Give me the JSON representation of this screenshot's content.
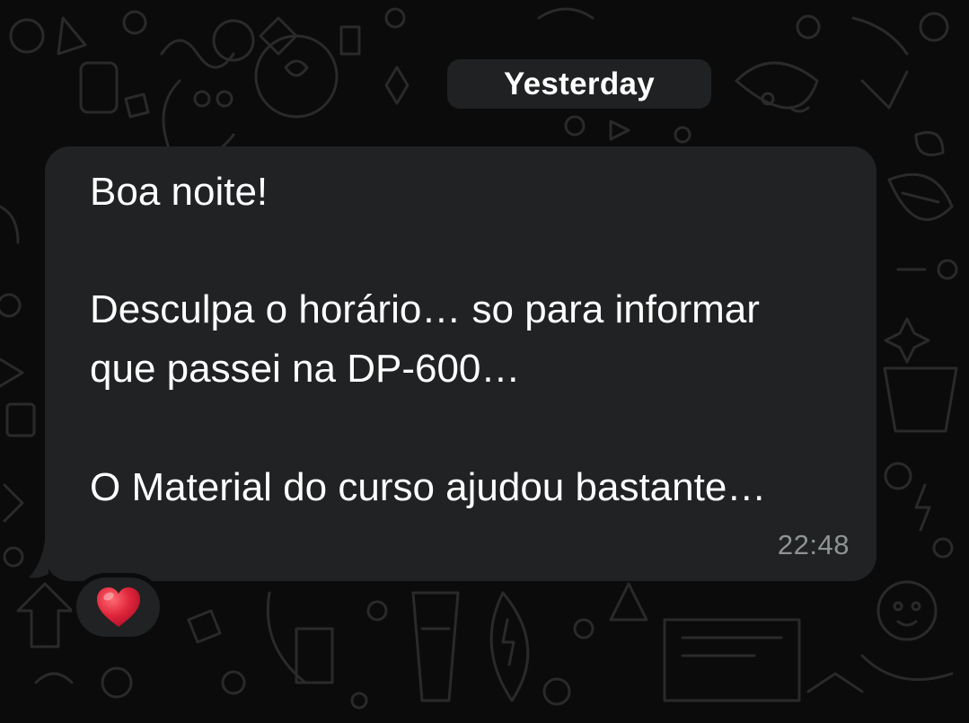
{
  "chat": {
    "date_separator": "Yesterday",
    "message": {
      "lines": [
        "Boa noite!",
        "Desculpa o horário… so para informar",
        "que passei na DP-600…",
        "O Material do curso ajudou bastante…"
      ],
      "time": "22:48",
      "reaction": "heart-emoji"
    }
  },
  "colors": {
    "background": "#0b0b0b",
    "bubble": "#202223",
    "text": "#ffffff",
    "timestamp": "#8f9394",
    "heart": "#e0263b"
  }
}
